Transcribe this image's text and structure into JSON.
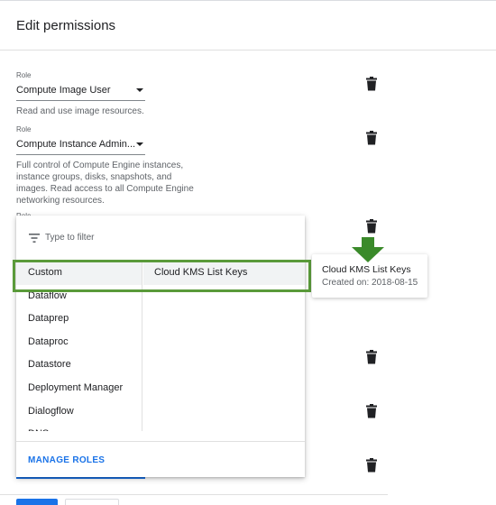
{
  "header": {
    "title": "Edit permissions"
  },
  "roles": [
    {
      "label": "Role",
      "value": "Compute Image User",
      "description": "Read and use image resources."
    },
    {
      "label": "Role",
      "value": "Compute Instance Admin...",
      "description": "Full control of Compute Engine instances, instance groups, disks, snapshots, and images. Read access to all Compute Engine networking resources."
    },
    {
      "label": "Role"
    }
  ],
  "dropdown": {
    "filter_placeholder": "Type to filter",
    "services": [
      "Custom",
      "Dataflow",
      "Dataprep",
      "Dataproc",
      "Datastore",
      "Deployment Manager",
      "Dialogflow",
      "DNS"
    ],
    "selected_service": "Custom",
    "roles": [
      "Cloud KMS List Keys"
    ],
    "manage_roles_label": "MANAGE ROLES"
  },
  "tooltip": {
    "title": "Cloud KMS List Keys",
    "subtitle": "Created on: 2018-08-15"
  },
  "icons": {
    "delete": "trash-icon",
    "filter": "filter-icon",
    "dropdown_caret": "caret-down-icon",
    "annotation_arrow": "arrow-down-icon"
  },
  "colors": {
    "accent": "#1a73e8",
    "highlight": "#5a9a3a",
    "arrow": "#3a8a2a"
  }
}
